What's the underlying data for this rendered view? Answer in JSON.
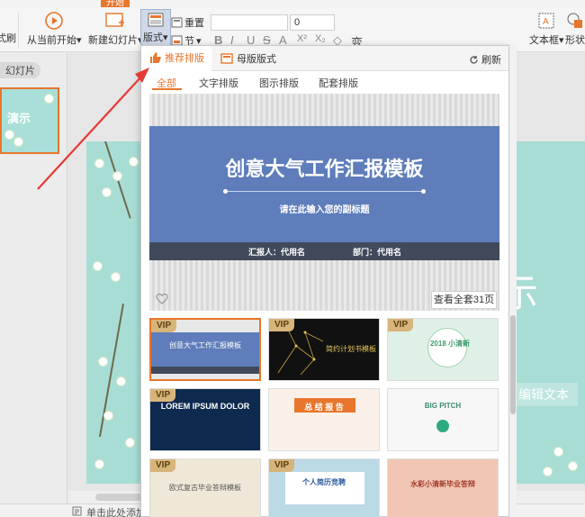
{
  "ribbon": {
    "start_from_current": "从当前开始",
    "start_from_current_caret": "▾",
    "new_slide": "新建幻灯片",
    "new_slide_caret": "▾",
    "layout": "版式",
    "layout_caret": "▾",
    "reset": "重置",
    "section": "节",
    "section_caret": "▾",
    "font_size_value": "0",
    "textbox": "文本框",
    "textbox_caret": "▾",
    "shape": "形状",
    "format_brush": "式刷",
    "format_buttons": [
      "B",
      "I",
      "U",
      "S",
      "A",
      "X²",
      "X₂",
      "◇",
      "变"
    ]
  },
  "left_panel": {
    "tab_label": "幻灯片",
    "thumb_text": "演示"
  },
  "slide": {
    "big_text": "示",
    "edit_text": "编辑文本"
  },
  "notes": {
    "placeholder": "单击此处添加"
  },
  "popup": {
    "tabs": [
      {
        "label": "推荐排版",
        "active": true
      },
      {
        "label": "母版版式",
        "active": false
      }
    ],
    "refresh": "刷新",
    "subtabs": [
      {
        "label": "全部",
        "active": true
      },
      {
        "label": "文字排版",
        "active": false
      },
      {
        "label": "图示排版",
        "active": false
      },
      {
        "label": "配套排版",
        "active": false
      }
    ],
    "preview": {
      "title": "创意大气工作汇报模板",
      "subtitle": "请在此输入您的副标题",
      "reporter": "汇报人：代用名",
      "department": "部门：代用名"
    },
    "view_all": "查看全套31页",
    "templates": [
      {
        "vip": "VIP",
        "title": "创意大气工作汇报模板",
        "selected": true
      },
      {
        "vip": "VIP",
        "title": "简约计划书模板",
        "selected": false
      },
      {
        "vip": "VIP",
        "title": "2018 小清新",
        "selected": false
      },
      {
        "vip": "VIP",
        "title": "LOREM IPSUM DOLOR",
        "selected": false
      },
      {
        "vip": "",
        "title": "总 结 报 告",
        "selected": false
      },
      {
        "vip": "",
        "title": "BIG PITCH",
        "selected": false
      },
      {
        "vip": "VIP",
        "title": "欧式复古毕业答辩模板",
        "selected": false
      },
      {
        "vip": "VIP",
        "title": "个人简历竞聘",
        "selected": false
      },
      {
        "vip": "",
        "title": "水彩小清新毕业答辩",
        "selected": false
      }
    ]
  },
  "colors": {
    "accent": "#e8762c",
    "preview_band": "#5e7dba",
    "slide_bg": "#a8ddd6",
    "vip_badge": "#d7b57a"
  }
}
